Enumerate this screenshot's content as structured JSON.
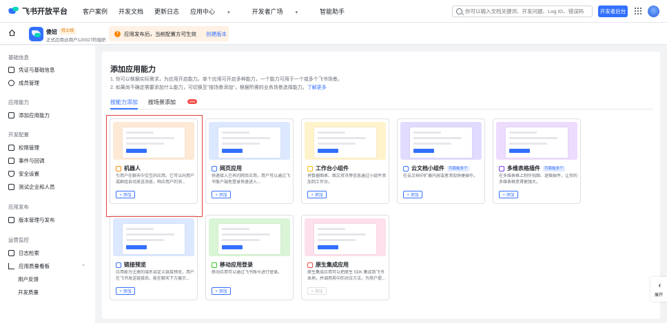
{
  "topnav": {
    "logo_text": "飞书开放平台",
    "links": [
      "客户案例",
      "开发文档",
      "更新日志",
      "应用中心",
      "开发者广场",
      "智能助手"
    ],
    "search_placeholder": "你可以输入文档关键词、开发问题、Log ID、错误码",
    "dev_console": "开发者后台"
  },
  "appbar": {
    "app_name": "傻妞",
    "status_badge": "待上线",
    "app_sub": "正式应用@用户120027的组织",
    "notice": "应用发布后，当前配置方可生效",
    "notice_link": "创建版本"
  },
  "sidebar": {
    "sections": [
      {
        "title": "基础信息",
        "items": [
          "凭证与基础信息",
          "成员管理"
        ]
      },
      {
        "title": "应用能力",
        "items": [
          "添加应用能力"
        ]
      },
      {
        "title": "开发配置",
        "items": [
          "权限管理",
          "事件与回调",
          "安全设置",
          "测试企业和人员"
        ]
      },
      {
        "title": "应用发布",
        "items": [
          "版本管理与发布"
        ]
      },
      {
        "title": "运营监控",
        "items": [
          "日志检索",
          "应用质量看板"
        ],
        "subitems": [
          "用户反馈",
          "开发质量"
        ]
      }
    ]
  },
  "main": {
    "title": "添加应用能力",
    "desc1": "1. 你可以根据实际需求，为应用开启能力。单个应用可开启多种能力，一个能力可用于一个或多个飞书场景。",
    "desc2": "2. 如果尚不确定需要添加什么能力，可切换至\"按场景添加\"，根据所需的业务场景选择能力。",
    "desc2_link": "了解更多",
    "tabs": [
      "按能力添加",
      "按场景添加"
    ],
    "new_badge": "new",
    "cards": [
      {
        "title": "机器人",
        "tag": "",
        "desc": "引用户在聊天中交互的应用。它可以向用户或群组自动发送消息，响应用户的消...",
        "btn": "+ 添加",
        "color": "#fde9d6",
        "icon": "robot-icon",
        "iconColor": "#ff8800"
      },
      {
        "title": "网页应用",
        "tag": "",
        "desc": "快速接入已有的网页应用，用户可以通过飞书客户端免登录快速进入...",
        "btn": "+ 添加",
        "color": "#dce8ff",
        "icon": "web-app-icon",
        "iconColor": "#3370ff"
      },
      {
        "title": "工作台小组件",
        "tag": "",
        "desc": "将数据图表、图文资讯等信息通过小组件添加到工作台。",
        "btn": "+ 添加",
        "color": "#fff3cc",
        "icon": "widget-icon",
        "iconColor": "#ffb800"
      },
      {
        "title": "云文档小组件",
        "tag": "可面板多个",
        "desc": "在云文档中扩展内容或者添加快捷操作。",
        "btn": "+ 添加",
        "color": "#e1dcff",
        "icon": "doc-widget-icon",
        "iconColor": "#3370ff"
      },
      {
        "title": "多维表格插件",
        "tag": "可面板多个",
        "desc": "在多维表格上制作视图、逻辑插件，让你的多维表格变得更强大。",
        "btn": "+ 添加",
        "color": "#eedcff",
        "icon": "bitable-icon",
        "iconColor": "#7f3bf5"
      },
      {
        "title": "链接预览",
        "tag": "",
        "desc": "应用能为注册的域名自定义链接预览，用户在飞书发送链接后，能在聊天下方展示...",
        "btn": "+ 添加",
        "color": "#dce8ff",
        "icon": "link-icon",
        "iconColor": "#3370ff"
      },
      {
        "title": "移动应用登录",
        "tag": "",
        "desc": "移动应用可以通过飞书账号进行登录。",
        "btn": "+ 添加",
        "color": "#d9f5d6",
        "icon": "mobile-login-icon",
        "iconColor": "#34c724"
      },
      {
        "title": "原生集成应用",
        "tag": "",
        "desc": "原生集成应用可以把原生 SDK 集成到飞书本地，并调用其中的对应方法，为用户提...",
        "btn": "+ 添加",
        "color": "#fde0ec",
        "icon": "native-app-icon",
        "iconColor": "#f54a45",
        "disabled": true
      }
    ]
  },
  "expand_label": "展开"
}
